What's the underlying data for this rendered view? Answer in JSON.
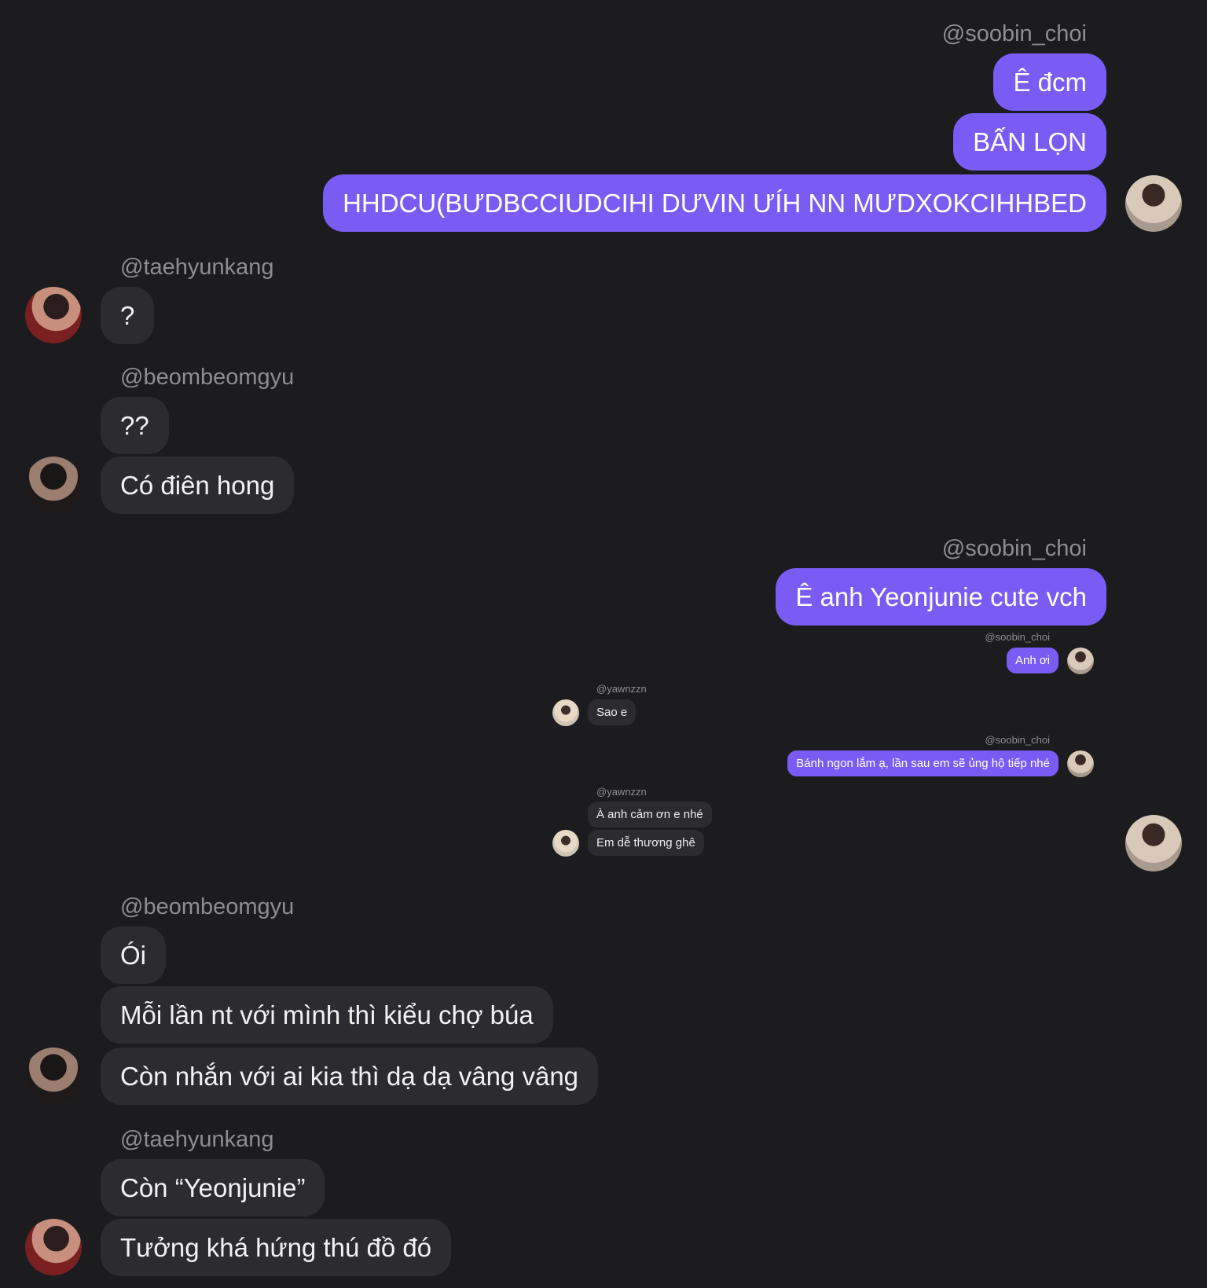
{
  "colors": {
    "background": "#1c1c1f",
    "outgoing_bubble": "#7a5cf4",
    "incoming_bubble": "#2c2c30",
    "username_text": "#8d8d93"
  },
  "group1": {
    "sender": "@soobin_choi",
    "messages": [
      "Ê đcm",
      "BẤN LỌN",
      "HHDCU(BƯDBCCIUDCIHI DƯVIN ƯÍH NN MƯDXOKCIHHBED"
    ]
  },
  "group2": {
    "sender": "@taehyunkang",
    "messages": [
      "?"
    ]
  },
  "group3": {
    "sender": "@beombeomgyu",
    "messages": [
      "??",
      "Có điên hong"
    ]
  },
  "group4": {
    "sender": "@soobin_choi",
    "messages": [
      "Ê anh Yeonjunie cute vch"
    ]
  },
  "embedded": {
    "m1_sender": "@soobin_choi",
    "m1_text": "Anh ơi",
    "m2_sender": "@yawnzzn",
    "m2_text": "Sao e",
    "m3_sender": "@soobin_choi",
    "m3_text": "Bánh ngon lắm ạ, lần sau em sẽ ủng hộ tiếp nhé",
    "m4_sender": "@yawnzzn",
    "m4_texts": [
      "À anh cảm ơn e nhé",
      "Em dễ thương ghê"
    ]
  },
  "group5": {
    "sender": "@beombeomgyu",
    "messages": [
      "Ói",
      "Mỗi lần nt với mình thì kiểu chợ búa",
      "Còn nhắn với ai kia thì dạ dạ vâng vâng"
    ]
  },
  "group6": {
    "sender": "@taehyunkang",
    "messages": [
      "Còn “Yeonjunie”",
      "Tưởng khá hứng thú đồ đó"
    ]
  }
}
